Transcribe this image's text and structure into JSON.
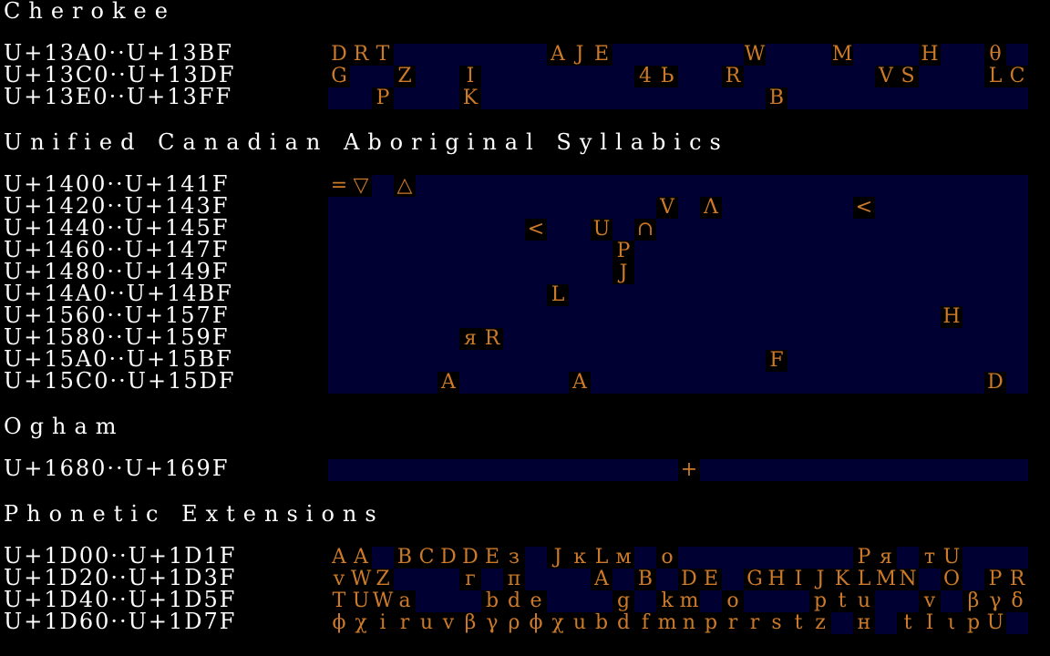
{
  "colors": {
    "background": "#000000",
    "text": "#ffffff",
    "glyph": "#cc7a2a",
    "bar": "#000033",
    "cell": "#000000"
  },
  "blocks": [
    {
      "title": "Cherokee",
      "rows": [
        {
          "range": "U+13A0··U+13BF",
          "glyphs": [
            [
              0,
              "D"
            ],
            [
              1,
              "R"
            ],
            [
              2,
              "T"
            ],
            [
              10,
              "A"
            ],
            [
              11,
              "J"
            ],
            [
              12,
              "E"
            ],
            [
              19,
              "W"
            ],
            [
              23,
              "M"
            ],
            [
              27,
              "H"
            ],
            [
              30,
              "θ"
            ]
          ]
        },
        {
          "range": "U+13C0··U+13DF",
          "glyphs": [
            [
              0,
              "G"
            ],
            [
              3,
              "Z"
            ],
            [
              6,
              "I"
            ],
            [
              14,
              "4"
            ],
            [
              15,
              "Ь"
            ],
            [
              18,
              "R"
            ],
            [
              25,
              "V"
            ],
            [
              26,
              "S"
            ],
            [
              30,
              "L"
            ],
            [
              31,
              "C"
            ]
          ]
        },
        {
          "range": "U+13E0··U+13FF",
          "glyphs": [
            [
              2,
              "P"
            ],
            [
              6,
              "K"
            ],
            [
              20,
              "B"
            ]
          ]
        }
      ]
    },
    {
      "title": "Unified Canadian Aboriginal Syllabics",
      "rows": [
        {
          "range": "U+1400··U+141F",
          "glyphs": [
            [
              0,
              "="
            ],
            [
              1,
              "▽"
            ],
            [
              3,
              "△"
            ]
          ]
        },
        {
          "range": "U+1420··U+143F",
          "glyphs": [
            [
              15,
              "V"
            ],
            [
              17,
              "Λ"
            ],
            [
              24,
              "<"
            ]
          ]
        },
        {
          "range": "U+1440··U+145F",
          "glyphs": [
            [
              9,
              "<"
            ],
            [
              12,
              "U"
            ],
            [
              14,
              "∩"
            ]
          ]
        },
        {
          "range": "U+1460··U+147F",
          "glyphs": [
            [
              13,
              "P"
            ]
          ]
        },
        {
          "range": "U+1480··U+149F",
          "glyphs": [
            [
              13,
              "J"
            ]
          ]
        },
        {
          "range": "U+14A0··U+14BF",
          "glyphs": [
            [
              10,
              "L"
            ]
          ]
        },
        {
          "range": "U+1560··U+157F",
          "glyphs": [
            [
              28,
              "H"
            ]
          ]
        },
        {
          "range": "U+1580··U+159F",
          "glyphs": [
            [
              6,
              "я"
            ],
            [
              7,
              "R"
            ]
          ]
        },
        {
          "range": "U+15A0··U+15BF",
          "glyphs": [
            [
              20,
              "F"
            ]
          ]
        },
        {
          "range": "U+15C0··U+15DF",
          "glyphs": [
            [
              5,
              "A"
            ],
            [
              11,
              "A"
            ],
            [
              30,
              "D"
            ]
          ]
        }
      ]
    },
    {
      "title": "Ogham",
      "rows": [
        {
          "range": "U+1680··U+169F",
          "glyphs": [
            [
              16,
              "+"
            ]
          ]
        }
      ]
    },
    {
      "title": "Phonetic Extensions",
      "rows": [
        {
          "range": "U+1D00··U+1D1F",
          "glyphs": [
            [
              0,
              "A"
            ],
            [
              1,
              "A"
            ],
            [
              3,
              "B"
            ],
            [
              4,
              "C"
            ],
            [
              5,
              "D"
            ],
            [
              6,
              "D"
            ],
            [
              7,
              "E"
            ],
            [
              8,
              "з"
            ],
            [
              10,
              "J"
            ],
            [
              11,
              "ĸ"
            ],
            [
              12,
              "L"
            ],
            [
              13,
              "м"
            ],
            [
              15,
              "o"
            ],
            [
              24,
              "P"
            ],
            [
              25,
              "я"
            ],
            [
              27,
              "т"
            ],
            [
              28,
              "U"
            ]
          ]
        },
        {
          "range": "U+1D20··U+1D3F",
          "glyphs": [
            [
              0,
              "v"
            ],
            [
              1,
              "W"
            ],
            [
              2,
              "Z"
            ],
            [
              6,
              "г"
            ],
            [
              8,
              "π"
            ],
            [
              12,
              "A"
            ],
            [
              14,
              "B"
            ],
            [
              16,
              "D"
            ],
            [
              17,
              "E"
            ],
            [
              19,
              "G"
            ],
            [
              20,
              "H"
            ],
            [
              21,
              "I"
            ],
            [
              22,
              "J"
            ],
            [
              23,
              "K"
            ],
            [
              24,
              "L"
            ],
            [
              25,
              "M"
            ],
            [
              26,
              "N"
            ],
            [
              28,
              "O"
            ],
            [
              30,
              "P"
            ],
            [
              31,
              "R"
            ]
          ]
        },
        {
          "range": "U+1D40··U+1D5F",
          "glyphs": [
            [
              0,
              "T"
            ],
            [
              1,
              "U"
            ],
            [
              2,
              "W"
            ],
            [
              3,
              "a"
            ],
            [
              7,
              "b"
            ],
            [
              8,
              "d"
            ],
            [
              9,
              "e"
            ],
            [
              13,
              "g"
            ],
            [
              15,
              "k"
            ],
            [
              16,
              "m"
            ],
            [
              18,
              "o"
            ],
            [
              22,
              "p"
            ],
            [
              23,
              "t"
            ],
            [
              24,
              "u"
            ],
            [
              27,
              "v"
            ],
            [
              29,
              "β"
            ],
            [
              30,
              "γ"
            ],
            [
              31,
              "δ"
            ]
          ]
        },
        {
          "range": "U+1D60··U+1D7F",
          "glyphs": [
            [
              0,
              "ϕ"
            ],
            [
              1,
              "χ"
            ],
            [
              2,
              "i"
            ],
            [
              3,
              "r"
            ],
            [
              4,
              "u"
            ],
            [
              5,
              "v"
            ],
            [
              6,
              "β"
            ],
            [
              7,
              "γ"
            ],
            [
              8,
              "ρ"
            ],
            [
              9,
              "ϕ"
            ],
            [
              10,
              "χ"
            ],
            [
              11,
              "u"
            ],
            [
              12,
              "b"
            ],
            [
              13,
              "d"
            ],
            [
              14,
              "f"
            ],
            [
              15,
              "m"
            ],
            [
              16,
              "n"
            ],
            [
              17,
              "p"
            ],
            [
              18,
              "r"
            ],
            [
              19,
              "r"
            ],
            [
              20,
              "s"
            ],
            [
              21,
              "t"
            ],
            [
              22,
              "z"
            ],
            [
              24,
              "н"
            ],
            [
              26,
              "t"
            ],
            [
              27,
              "I"
            ],
            [
              28,
              "ι"
            ],
            [
              29,
              "p"
            ],
            [
              30,
              "U"
            ]
          ]
        }
      ]
    }
  ]
}
